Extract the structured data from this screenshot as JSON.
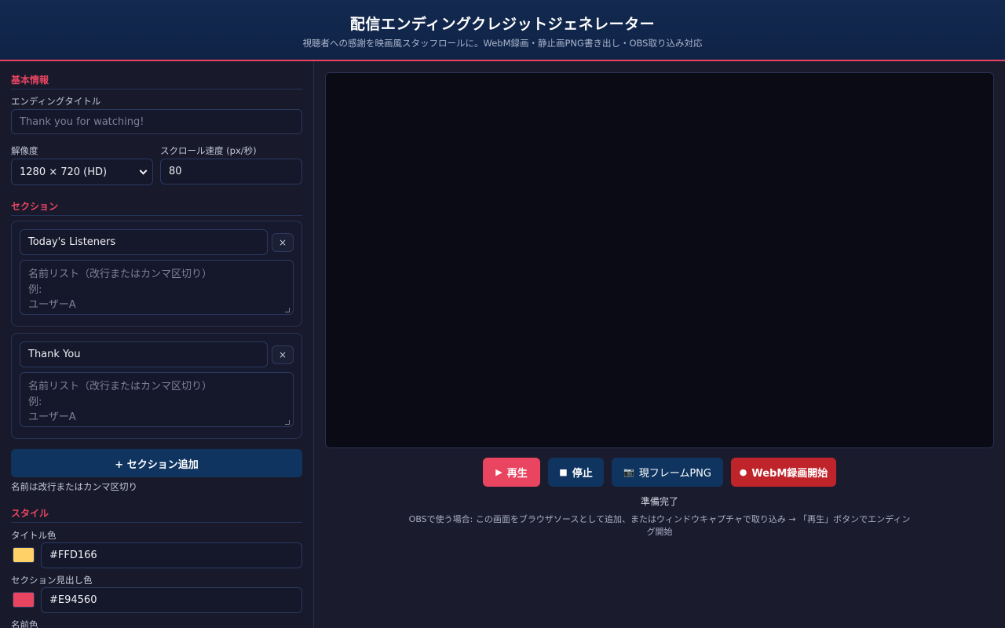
{
  "header": {
    "title": "配信エンディングクレジットジェネレーター",
    "subtitle": "視聴者への感謝を映画風スタッフロールに。WebM録画・静止画PNG書き出し・OBS取り込み対応"
  },
  "basic": {
    "heading": "基本情報",
    "title_label": "エンディングタイトル",
    "title_placeholder": "Thank you for watching!",
    "resolution_label": "解像度",
    "resolution_value": "1280 × 720 (HD)",
    "speed_label": "スクロール速度 (px/秒)",
    "speed_value": "80"
  },
  "sections": {
    "heading": "セクション",
    "items": [
      {
        "name": "Today's Listeners",
        "names_placeholder": "名前リスト（改行またはカンマ区切り）\n例:\nユーザーA",
        "remove_label": "×"
      },
      {
        "name": "Thank You",
        "names_placeholder": "名前リスト（改行またはカンマ区切り）\n例:\nユーザーA",
        "remove_label": "×"
      }
    ],
    "add_label": "+ セクション追加",
    "hint": "名前は改行またはカンマ区切り"
  },
  "style": {
    "heading": "スタイル",
    "title_color_label": "タイトル色",
    "title_color": "#FFD166",
    "section_color_label": "セクション見出し色",
    "section_color": "#E94560",
    "name_color_label": "名前色"
  },
  "controls": {
    "play_label": "再生",
    "play_icon": "▶",
    "stop_label": "停止",
    "stop_icon": "■",
    "png_label": "現フレームPNG",
    "png_icon": "📷",
    "record_label": "WebM録画開始",
    "record_icon": "●"
  },
  "status": "準備完了",
  "obs_note": "OBSで使う場合: この画面をブラウザソースとして追加、またはウィンドウキャプチャで取り込み → 「再生」ボタンでエンディング開始",
  "colors": {
    "accent": "#e94560",
    "primary": "#0f3460",
    "record": "#c0242b"
  }
}
